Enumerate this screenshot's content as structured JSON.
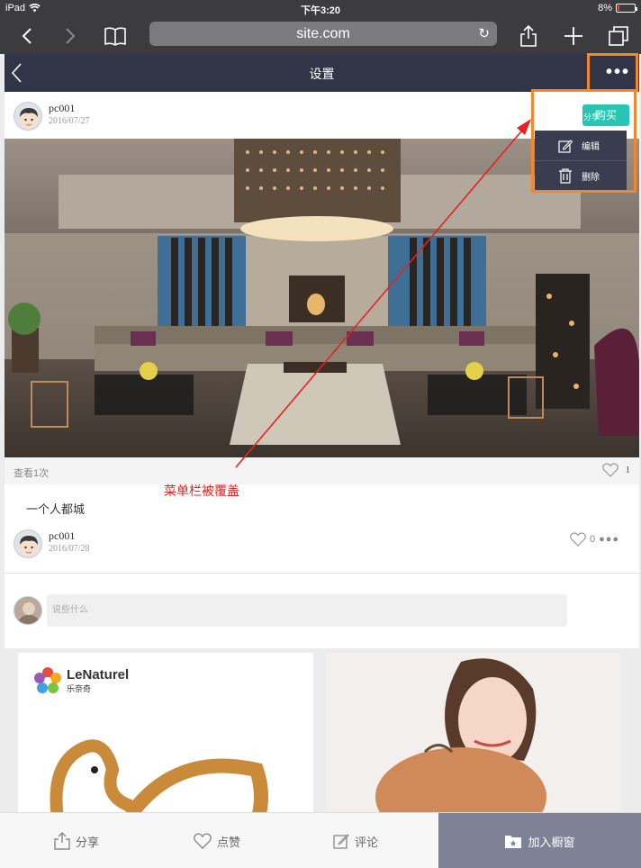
{
  "status_bar": {
    "device": "iPad",
    "time": "下午3:20",
    "battery": "8%"
  },
  "browser": {
    "url": "site.com"
  },
  "header": {
    "title": "设置"
  },
  "post": {
    "user": "pc001",
    "date": "2016/07/27",
    "views": "查看1次",
    "like_count": "1",
    "caption": "一个人都城"
  },
  "comment": {
    "user": "pc001",
    "date": "2016/07/28",
    "like_count": "0",
    "input_placeholder": "说些什么"
  },
  "menu": {
    "buy_label": "购买",
    "share_label": "分享",
    "edit_label": "编辑",
    "delete_label": "删除"
  },
  "annotation": {
    "text": "菜单栏被覆盖",
    "color": "#e52222"
  },
  "recommend": {
    "brand_name": "LeNaturel",
    "brand_cn": "乐奈奇"
  },
  "bottom_bar": {
    "share": "分享",
    "like": "点赞",
    "comment": "评论",
    "add_window": "加入橱窗"
  },
  "colors": {
    "header_bg": "#323548",
    "accent": "#26c6b3",
    "highlight": "#f3872c",
    "window_btn": "#7f8197"
  }
}
